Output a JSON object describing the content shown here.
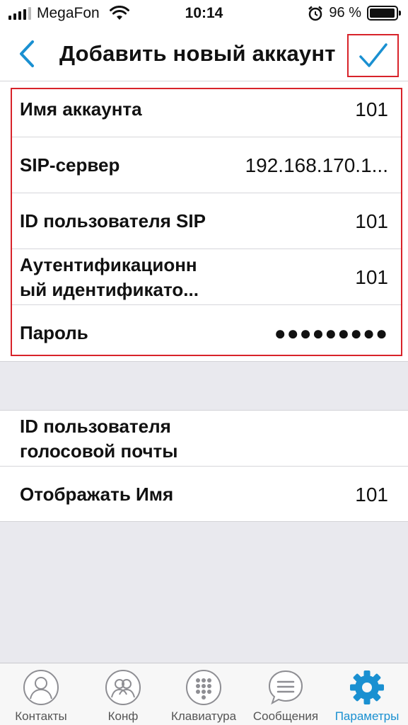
{
  "status_bar": {
    "carrier": "MegaFon",
    "time": "10:14",
    "battery_percent": "96 %",
    "battery_level": 0.96
  },
  "nav": {
    "title": "Добавить новый аккаунт",
    "back_icon": "chevron-left-icon",
    "confirm_icon": "checkmark-icon",
    "accent_color": "#1a90d1"
  },
  "account_fields": [
    {
      "label": "Имя аккаунта",
      "value": "101"
    },
    {
      "label": "SIP-сервер",
      "value": "192.168.170.1..."
    },
    {
      "label": "ID пользователя SIP",
      "value": "101"
    },
    {
      "label": "Аутентификационн ый идентификато...",
      "label_line1": "Аутентификационн",
      "label_line2": "ый идентификато...",
      "value": "101"
    },
    {
      "label": "Пароль",
      "value": "●●●●●●●●●"
    }
  ],
  "extra_fields": [
    {
      "label_line1": "ID пользователя",
      "label_line2": "голосовой почты",
      "value": ""
    },
    {
      "label": "Отображать Имя",
      "value": "101"
    }
  ],
  "tabs": [
    {
      "label": "Контакты",
      "icon": "contact-icon",
      "active": false
    },
    {
      "label": "Конф",
      "icon": "conference-icon",
      "active": false
    },
    {
      "label": "Клавиатура",
      "icon": "keypad-icon",
      "active": false
    },
    {
      "label": "Сообщения",
      "icon": "message-icon",
      "active": false
    },
    {
      "label": "Параметры",
      "icon": "gear-icon",
      "active": true
    }
  ],
  "highlight_color": "#d8232a"
}
